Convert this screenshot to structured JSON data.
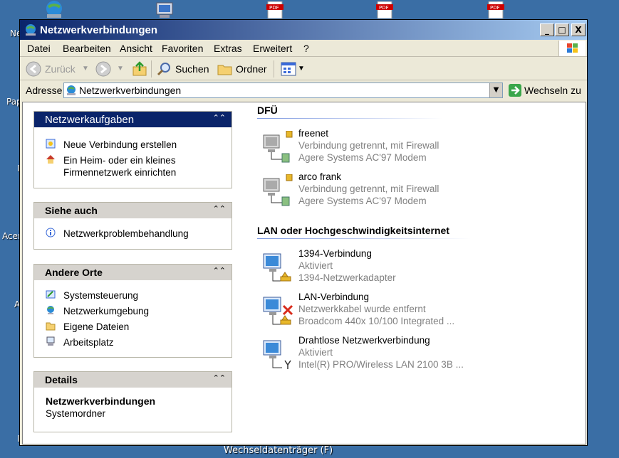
{
  "desktop": {
    "bottom_label": "Wechseldatenträger (F)",
    "left_labels": [
      "Ne",
      "Pap",
      "I",
      "Acer",
      "A",
      "I"
    ]
  },
  "window": {
    "title": "Netzwerkverbindungen",
    "controls": {
      "minimize": "_",
      "maximize": "□",
      "close": "X"
    }
  },
  "menu": [
    "Datei",
    "Bearbeiten",
    "Ansicht",
    "Favoriten",
    "Extras",
    "Erweitert",
    "?"
  ],
  "toolbar": {
    "back": "Zurück",
    "search": "Suchen",
    "folders": "Ordner"
  },
  "address": {
    "label": "Adresse",
    "value": "Netzwerkverbindungen",
    "go": "Wechseln zu"
  },
  "tasks": {
    "network_tasks": {
      "title": "Netzwerkaufgaben",
      "items": [
        "Neue Verbindung erstellen",
        "Ein Heim- oder ein kleines",
        "Firmennetzwerk einrichten"
      ]
    },
    "see_also": {
      "title": "Siehe auch",
      "items": [
        "Netzwerkproblembehandlung"
      ]
    },
    "other_places": {
      "title": "Andere Orte",
      "items": [
        "Systemsteuerung",
        "Netzwerkumgebung",
        "Eigene Dateien",
        "Arbeitsplatz"
      ]
    },
    "details": {
      "title": "Details",
      "name": "Netzwerkverbindungen",
      "type": "Systemordner"
    }
  },
  "groups": {
    "dfu": {
      "title": "DFÜ",
      "connections": [
        {
          "name": "freenet",
          "status": "Verbindung getrennt, mit Firewall",
          "device": "Agere Systems AC'97 Modem"
        },
        {
          "name": "arco frank",
          "status": "Verbindung getrennt, mit Firewall",
          "device": "Agere Systems AC'97 Modem"
        }
      ]
    },
    "lan": {
      "title": "LAN oder Hochgeschwindigkeitsinternet",
      "connections": [
        {
          "name": "1394-Verbindung",
          "status": "Aktiviert",
          "device": "1394-Netzwerkadapter"
        },
        {
          "name": "LAN-Verbindung",
          "status": "Netzwerkkabel wurde entfernt",
          "device": "Broadcom 440x 10/100 Integrated ..."
        },
        {
          "name": "Drahtlose Netzwerkverbindung",
          "status": "Aktiviert",
          "device": "Intel(R) PRO/Wireless LAN 2100 3B ..."
        }
      ]
    }
  },
  "colors": {
    "desktop": "#3a6ea5",
    "title_bar": "#0a246a",
    "panel_header": "#d6d3ce"
  }
}
